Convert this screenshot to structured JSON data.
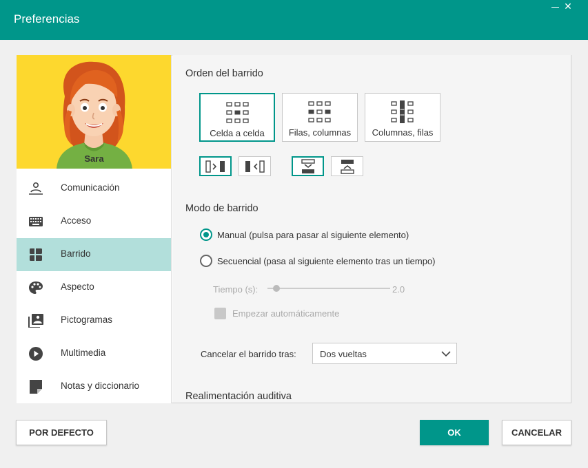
{
  "window": {
    "title": "Preferencias",
    "minimize_icon": "minimize-icon",
    "close_glyph": "✕"
  },
  "user": {
    "name": "Sara"
  },
  "sidebar": {
    "items": [
      {
        "label": "Comunicación",
        "icon": "communication-icon"
      },
      {
        "label": "Acceso",
        "icon": "keyboard-icon"
      },
      {
        "label": "Barrido",
        "icon": "scan-icon",
        "active": true
      },
      {
        "label": "Aspecto",
        "icon": "palette-icon"
      },
      {
        "label": "Pictogramas",
        "icon": "pictograms-icon"
      },
      {
        "label": "Multimedia",
        "icon": "play-icon"
      },
      {
        "label": "Notas y diccionario",
        "icon": "note-icon"
      }
    ]
  },
  "scan_order": {
    "title": "Orden del barrido",
    "options": [
      {
        "label": "Celda a celda",
        "selected": true
      },
      {
        "label": "Filas, columnas",
        "selected": false
      },
      {
        "label": "Columnas, filas",
        "selected": false
      }
    ]
  },
  "scan_mode": {
    "title": "Modo de barrido",
    "manual_label": "Manual (pulsa para pasar al siguiente elemento)",
    "sequential_label": "Secuencial (pasa al siguiente elemento tras un tiempo)",
    "selected": "manual",
    "time_label": "Tiempo (s):",
    "time_value": "2.0",
    "auto_start_label": "Empezar automáticamente",
    "cancel_label": "Cancelar el barrido tras:",
    "cancel_value": "Dos vueltas"
  },
  "audio_feedback": {
    "title": "Realimentación auditiva"
  },
  "footer": {
    "default_label": "POR DEFECTO",
    "ok_label": "OK",
    "cancel_label": "CANCELAR"
  },
  "colors": {
    "accent": "#00968a",
    "active_item": "#b2dfdb",
    "avatar_bg": "#fdd82e"
  }
}
